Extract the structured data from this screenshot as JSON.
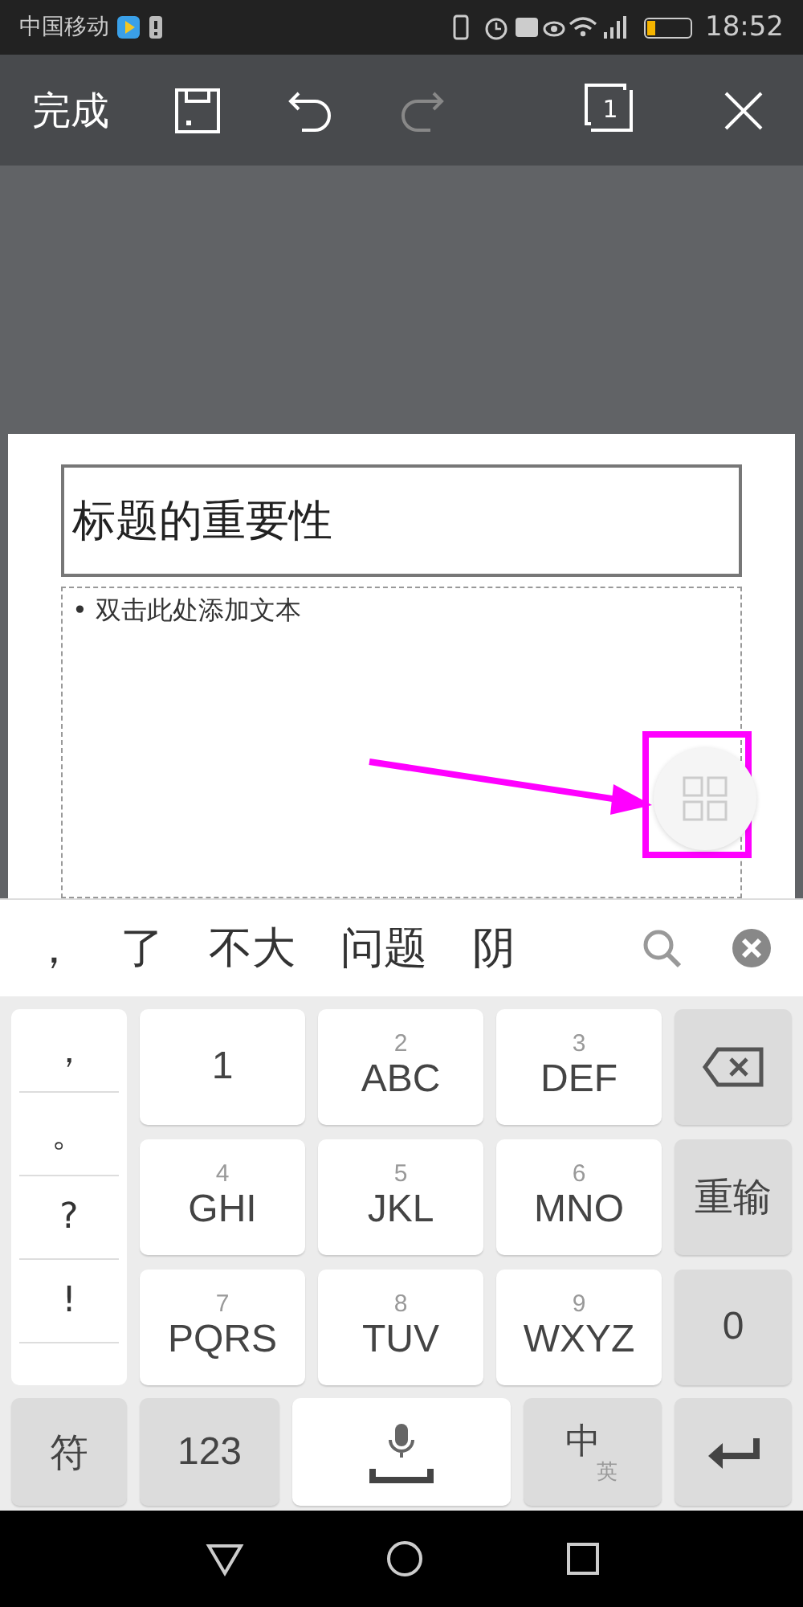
{
  "status_bar": {
    "carrier": "中国移动",
    "time": "18:52",
    "battery": {
      "level": 0.2
    }
  },
  "toolbar": {
    "done": "完成",
    "undo_disabled": false,
    "redo_disabled": true,
    "page_count": "1"
  },
  "slide": {
    "title": "标题的重要性",
    "body_bullet": "•",
    "body_placeholder": "双击此处添加文本"
  },
  "candidates": [
    "，",
    "了",
    "不大",
    "问题",
    "阴"
  ],
  "keyboard": {
    "symbols": [
      "，",
      "。",
      "?",
      "!"
    ],
    "keys": [
      {
        "kind": "digit",
        "digit": "1"
      },
      {
        "kind": "letters",
        "digit": "2",
        "letters": "ABC"
      },
      {
        "kind": "letters",
        "digit": "3",
        "letters": "DEF"
      },
      {
        "kind": "backspace"
      },
      {
        "kind": "letters",
        "digit": "4",
        "letters": "GHI"
      },
      {
        "kind": "letters",
        "digit": "5",
        "letters": "JKL"
      },
      {
        "kind": "letters",
        "digit": "6",
        "letters": "MNO"
      },
      {
        "kind": "function",
        "label": "重输"
      },
      {
        "kind": "letters",
        "digit": "7",
        "letters": "PQRS"
      },
      {
        "kind": "letters",
        "digit": "8",
        "letters": "TUV"
      },
      {
        "kind": "letters",
        "digit": "9",
        "letters": "WXYZ"
      },
      {
        "kind": "function",
        "label": "0"
      }
    ],
    "bottom": {
      "symbols": "符",
      "numbers": "123",
      "lang_main": "中",
      "lang_sub": "英"
    }
  }
}
